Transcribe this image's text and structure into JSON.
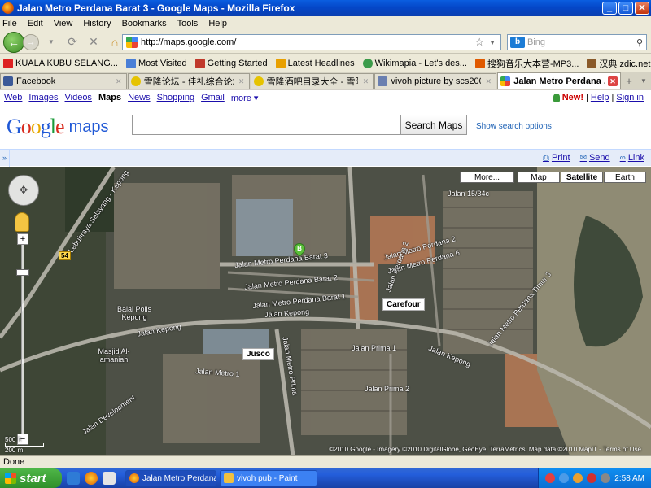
{
  "window": {
    "title": "Jalan Metro Perdana Barat 3 - Google Maps - Mozilla Firefox"
  },
  "menubar": [
    "File",
    "Edit",
    "View",
    "History",
    "Bookmarks",
    "Tools",
    "Help"
  ],
  "navbar": {
    "url": "http://maps.google.com/",
    "search_placeholder": "Bing"
  },
  "bookmarks": [
    {
      "label": "KUALA KUBU SELANG...",
      "color": "#d22"
    },
    {
      "label": "Most Visited",
      "color": "#4a7fd6"
    },
    {
      "label": "Getting Started",
      "color": "#c0392b"
    },
    {
      "label": "Latest Headlines",
      "color": "#e8a000"
    },
    {
      "label": "Wikimapia - Let's des...",
      "color": "#3c9b4a"
    },
    {
      "label": "搜狗音乐大本营-MP3...",
      "color": "#e05a00"
    },
    {
      "label": "汉典 zdic.net",
      "color": "#8a5a2a"
    }
  ],
  "tabs": [
    {
      "label": "Facebook",
      "color": "#3b5998",
      "active": false
    },
    {
      "label": "雪隆论坛 - 佳礼综合论坛...",
      "color": "#e6c300",
      "active": false
    },
    {
      "label": "雪隆酒吧目录大全 - 雪隆...",
      "color": "#e6c300",
      "active": false
    },
    {
      "label": "vivoh picture by scs200...",
      "color": "#6a7fb0",
      "active": false
    },
    {
      "label": "Jalan Metro Perdana ...",
      "color": "#4285f4",
      "active": true
    }
  ],
  "gbar": {
    "links": [
      "Web",
      "Images",
      "Videos",
      "Maps",
      "News",
      "Shopping",
      "Gmail",
      "more ▾"
    ],
    "new_label": "New!",
    "help": "Help",
    "signin": "Sign in",
    "sep": "|"
  },
  "gheader": {
    "logo_maps": "maps",
    "search_button": "Search Maps",
    "options": "Show search options"
  },
  "mapbar": {
    "print": "Print",
    "send": "Send",
    "link": "Link"
  },
  "map": {
    "types": [
      "More...",
      "Map",
      "Satellite",
      "Earth"
    ],
    "active_type": "Satellite",
    "marker_label": "B",
    "pois": [
      "Carefour",
      "Jusco"
    ],
    "labels": [
      "Jalan Metro Perdana Barat 3",
      "Jalan Metro Perdana Barat 2",
      "Jalan Metro Perdana Barat 1",
      "Jalan Metro Perdana 2",
      "Jalan Metro Perdana 6",
      "Jalan Metro Perdana Timur 3",
      "Jalan Kepong",
      "Jalan Kepong",
      "Jalan Kepong",
      "Jalan Prima 1",
      "Jalan Prima 2",
      "Jalan Metro 1",
      "Jalan Metro Prima",
      "Masjid Al-amaniah",
      "Balai Polis Kepong",
      "Lebuhraya Selayang - Kepong",
      "Jalan Development",
      "Jalan 15/34c",
      "Jalan Perdana 2"
    ],
    "route_shield": "54",
    "copyright": "©2010 Google - Imagery ©2010 DigitalGlobe, GeoEye, TerraMetrics, Map data ©2010 MapIT - Terms of Use",
    "scale_ft": "500 ft",
    "scale_m": "200 m"
  },
  "status": "Done",
  "taskbar": {
    "start": "start",
    "tasks": [
      "Jalan Metro Perdana ...",
      "vivoh pub - Paint"
    ],
    "clock": "2:58 AM"
  }
}
